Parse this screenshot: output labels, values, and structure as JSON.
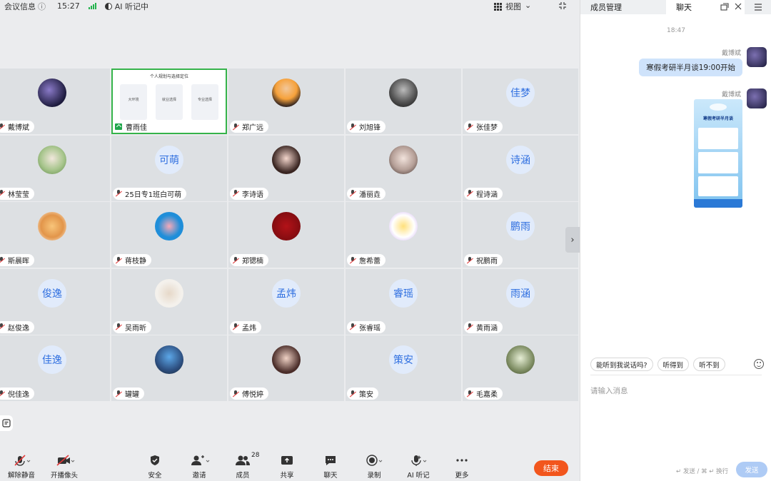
{
  "topbar": {
    "meeting_info": "会议信息",
    "info_icon": "ⓘ",
    "time": "15:27",
    "ai_status": "AI 听记中",
    "view_label": "视图",
    "view_caret": "⌄"
  },
  "colors": {
    "accent": "#2f6fe0",
    "end_button": "#f2561d",
    "active_speaker_border": "#35b34a",
    "signal": "#22b24c",
    "bubble": "#cfe3fb"
  },
  "shared_screen": {
    "title": "个人规划与选择定位",
    "cards": [
      "大环境",
      "就业选择",
      "专业选择"
    ]
  },
  "participants": [
    {
      "name": "戴博斌",
      "avatar_text": "",
      "avatar_style": "photo-dark"
    },
    {
      "name": "曹雨佳",
      "avatar_text": "",
      "avatar_style": "shared-screen",
      "sharing": true
    },
    {
      "name": "郑广远",
      "avatar_text": "",
      "avatar_style": "photo-anime"
    },
    {
      "name": "刘旭锋",
      "avatar_text": "",
      "avatar_style": "photo-bw"
    },
    {
      "name": "张佳梦",
      "avatar_text": "佳梦",
      "avatar_style": "text"
    },
    {
      "name": "林莹莹",
      "avatar_text": "",
      "avatar_style": "photo-green"
    },
    {
      "name": "25日专1班白可萌",
      "avatar_text": "可萌",
      "avatar_style": "text"
    },
    {
      "name": "李诗语",
      "avatar_text": "",
      "avatar_style": "photo-girl"
    },
    {
      "name": "潘丽垚",
      "avatar_text": "",
      "avatar_style": "photo-girl2"
    },
    {
      "name": "程诗涵",
      "avatar_text": "诗涵",
      "avatar_style": "text"
    },
    {
      "name": "斯晨晖",
      "avatar_text": "",
      "avatar_style": "photo-cat"
    },
    {
      "name": "蒋枝静",
      "avatar_text": "",
      "avatar_style": "photo-blue"
    },
    {
      "name": "郑锶楠",
      "avatar_text": "",
      "avatar_style": "photo-red"
    },
    {
      "name": "詹希蕾",
      "avatar_text": "",
      "avatar_style": "photo-cartoon"
    },
    {
      "name": "祝鹏雨",
      "avatar_text": "鹏雨",
      "avatar_style": "text"
    },
    {
      "name": "赵俊逸",
      "avatar_text": "俊逸",
      "avatar_style": "text"
    },
    {
      "name": "吴雨昕",
      "avatar_text": "",
      "avatar_style": "photo-kid"
    },
    {
      "name": "孟炜",
      "avatar_text": "孟炜",
      "avatar_style": "text"
    },
    {
      "name": "张睿瑶",
      "avatar_text": "睿瑶",
      "avatar_style": "text"
    },
    {
      "name": "黄雨涵",
      "avatar_text": "雨涵",
      "avatar_style": "text"
    },
    {
      "name": "倪佳逸",
      "avatar_text": "佳逸",
      "avatar_style": "text"
    },
    {
      "name": "罐罐",
      "avatar_text": "",
      "avatar_style": "photo-boy"
    },
    {
      "name": "傅悦婷",
      "avatar_text": "",
      "avatar_style": "photo-anime2"
    },
    {
      "name": "策安",
      "avatar_text": "策安",
      "avatar_style": "text"
    },
    {
      "name": "毛嘉柔",
      "avatar_text": "",
      "avatar_style": "photo-anime3"
    }
  ],
  "toolbar": {
    "unmute": "解除静音",
    "camera": "开播像头",
    "security": "安全",
    "invite": "邀请",
    "members": "成员",
    "member_count": "28",
    "share": "共享",
    "chat": "聊天",
    "record": "录制",
    "ai_notes": "AI 听记",
    "more": "更多",
    "end": "结束"
  },
  "chat_panel": {
    "tab_members": "成员管理",
    "tab_chat": "聊天",
    "timestamp": "18:47",
    "messages": [
      {
        "sender": "戴博斌",
        "text": "寒假考研半月谈19:00开始"
      },
      {
        "sender": "戴博斌",
        "type": "image",
        "poster_title": "寒假考研半月谈"
      }
    ],
    "quick_replies": [
      "能听到我说话吗?",
      "听得到",
      "听不到"
    ],
    "input_placeholder": "请输入消息",
    "send_hint": "↵ 发送 / ⌘ ↵ 换行",
    "send_button": "发送"
  }
}
